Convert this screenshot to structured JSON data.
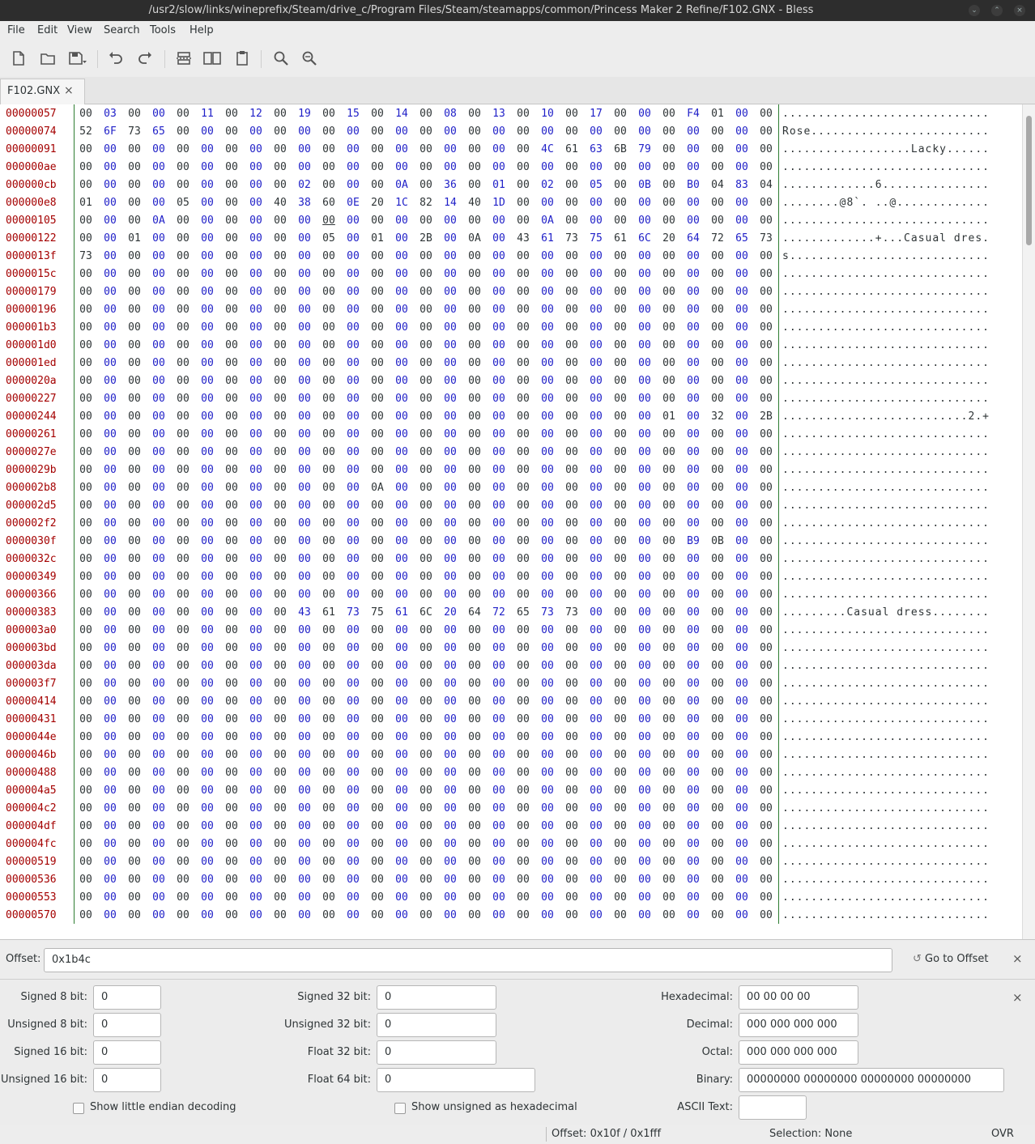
{
  "window": {
    "title": "/usr2/slow/links/wineprefix/Steam/drive_c/Program Files/Steam/steamapps/common/Princess Maker 2 Refine/F102.GNX - Bless"
  },
  "menu": [
    "File",
    "Edit",
    "View",
    "Search",
    "Tools",
    "Help"
  ],
  "toolbar": [
    "new-file-icon",
    "open-folder-icon",
    "save-dropdown-icon",
    "undo-icon",
    "redo-icon",
    "cut-icon",
    "copy-icon",
    "paste-icon",
    "find-icon",
    "find-replace-icon"
  ],
  "tabs": [
    {
      "label": "F102.GNX"
    }
  ],
  "hex": {
    "offsets": [
      "00000057",
      "00000074",
      "00000091",
      "000000ae",
      "000000cb",
      "000000e8",
      "00000105",
      "00000122",
      "0000013f",
      "0000015c",
      "00000179",
      "00000196",
      "000001b3",
      "000001d0",
      "000001ed",
      "0000020a",
      "00000227",
      "00000244",
      "00000261",
      "0000027e",
      "0000029b",
      "000002b8",
      "000002d5",
      "000002f2",
      "0000030f",
      "0000032c",
      "00000349",
      "00000366",
      "00000383",
      "000003a0",
      "000003bd",
      "000003da",
      "000003f7",
      "00000414",
      "00000431",
      "0000044e",
      "0000046b",
      "00000488",
      "000004a5",
      "000004c2",
      "000004df",
      "000004fc",
      "00000519",
      "00000536",
      "00000553",
      "00000570"
    ],
    "nonzero": {
      "0": {
        "1": "03",
        "5": "11",
        "7": "12",
        "9": "19",
        "11": "15",
        "13": "14",
        "15": "08",
        "17": "13",
        "19": "10",
        "21": "17",
        "25": "F4",
        "26": "01"
      },
      "1": {
        "0": "52",
        "1": "6F",
        "2": "73",
        "3": "65"
      },
      "2": {
        "19": "4C",
        "20": "61",
        "21": "63",
        "22": "6B",
        "23": "79"
      },
      "4": {
        "9": "02",
        "13": "0A",
        "15": "36",
        "17": "01",
        "19": "02",
        "21": "05",
        "23": "0B",
        "25": "B0",
        "26": "04",
        "27": "83",
        "28": "04"
      },
      "5": {
        "0": "01",
        "4": "05",
        "8": "40",
        "9": "38",
        "10": "60",
        "11": "0E",
        "12": "20",
        "13": "1C",
        "14": "82",
        "15": "14",
        "16": "40",
        "17": "1D"
      },
      "6": {
        "3": "0A",
        "19": "0A"
      },
      "7": {
        "2": "01",
        "10": "05",
        "12": "01",
        "14": "2B",
        "16": "0A",
        "18": "43",
        "19": "61",
        "20": "73",
        "21": "75",
        "22": "61",
        "23": "6C",
        "24": "20",
        "25": "64",
        "26": "72",
        "27": "65",
        "28": "73"
      },
      "8": {
        "0": "73"
      },
      "17": {
        "24": "01",
        "26": "32",
        "28": "2B"
      },
      "21": {
        "12": "0A"
      },
      "24": {
        "25": "B9",
        "26": "0B"
      },
      "28": {
        "9": "43",
        "10": "61",
        "11": "73",
        "12": "75",
        "13": "61",
        "14": "6C",
        "15": "20",
        "16": "64",
        "17": "72",
        "18": "65",
        "19": "73",
        "20": "73"
      }
    },
    "ascii_lines": {
      "1": "Rose.........................",
      "2": "..................Lacky.....",
      "4": ".............6..........",
      "5": "........@8`. ..@.........",
      "7": ".............+...Casual dres",
      "8": "s............................",
      "17": "..........................2.+",
      "28": ".........Casual dress.........."
    },
    "cursor": {
      "row": 6,
      "col": 10
    }
  },
  "offset_bar": {
    "label": "Offset:",
    "value": "0x1b4c",
    "goto_label": "Go to Offset"
  },
  "data_inspector": {
    "signed8": {
      "label": "Signed 8 bit:",
      "value": "0"
    },
    "unsigned8": {
      "label": "Unsigned 8 bit:",
      "value": "0"
    },
    "signed16": {
      "label": "Signed 16 bit:",
      "value": "0"
    },
    "unsigned16": {
      "label": "Unsigned 16 bit:",
      "value": "0"
    },
    "signed32": {
      "label": "Signed 32 bit:",
      "value": "0"
    },
    "unsigned32": {
      "label": "Unsigned 32 bit:",
      "value": "0"
    },
    "float32": {
      "label": "Float 32 bit:",
      "value": "0"
    },
    "float64": {
      "label": "Float 64 bit:",
      "value": "0"
    },
    "hex": {
      "label": "Hexadecimal:",
      "value": "00 00 00 00"
    },
    "decimal": {
      "label": "Decimal:",
      "value": "000 000 000 000"
    },
    "octal": {
      "label": "Octal:",
      "value": "000 000 000 000"
    },
    "binary": {
      "label": "Binary:",
      "value": "00000000 00000000 00000000 00000000"
    },
    "ascii": {
      "label": "ASCII Text:",
      "value": ""
    },
    "little_endian": {
      "label": "Show little endian decoding",
      "checked": false
    },
    "unsigned_hex": {
      "label": "Show unsigned as hexadecimal",
      "checked": false
    }
  },
  "status": {
    "offset": "Offset: 0x10f / 0x1fff",
    "selection": "Selection: None",
    "mode": "OVR"
  }
}
